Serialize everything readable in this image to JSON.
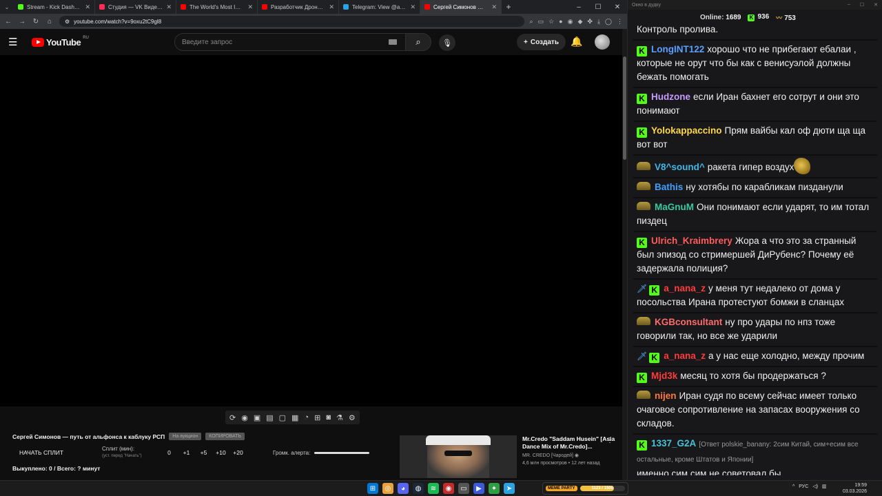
{
  "browser": {
    "tabs": [
      {
        "title": "Stream - Kick Dashboard",
        "color": "#53fc18"
      },
      {
        "title": "Студия — VK Видео Live",
        "color": "#ff2d55"
      },
      {
        "title": "The World's Most Important M",
        "color": "#ff0000"
      },
      {
        "title": "Разработчик Дронов: вся",
        "color": "#ff0000"
      },
      {
        "title": "Telegram: View @asafevitas",
        "color": "#2aa3e0"
      },
      {
        "title": "Сергей Симонов — путь от ал",
        "color": "#ff0000"
      }
    ],
    "url": "youtube.com/watch?v=9oxu2tC9gl8"
  },
  "youtube": {
    "logo_text": "YouTube",
    "region": "RU",
    "search_placeholder": "Введите запрос",
    "create_label": "Создать"
  },
  "info": {
    "video_title": "Сергей Симонов — путь от альфонса к каблуку РСП",
    "pill1": "На аукцион",
    "pill2": "КОПИРОВАТЬ",
    "start_split": "НАЧАТЬ СПЛИТ",
    "split_label": "Сплит (мин):",
    "split_hint": "(уст. перед \"Начать\")",
    "split_values": [
      "0",
      "+1",
      "+5",
      "+10",
      "+20"
    ],
    "alert_label": "Громк. алерта:",
    "alert_volume": 1.0,
    "bought": "Выкуплено: 0 / Всего: ? минут"
  },
  "recommendation": {
    "title": "Mr.Credo \"Saddam Husein\" [Asia Dance Mix of Mr.Credo]...",
    "channel": "MR. CREDO [Чародей]",
    "views": "4,6 млн просмотров • 12 лет назад"
  },
  "chat": {
    "window_title": "Окно в дудку",
    "online_label": "Online:",
    "online_count": "1689",
    "kick_count": "936",
    "yt_count": "753",
    "messages": [
      {
        "badge": "none",
        "user": "",
        "color": "#ffffff",
        "text": "Контроль пролива."
      },
      {
        "badge": "kick",
        "user": "LongINT122",
        "color": "#5aa0ff",
        "text": "хорошо что не прибегают ебалаи , которые не орут что бы как с венисуэлой должны бежать помогать"
      },
      {
        "badge": "kick",
        "user": "Hudzone",
        "color": "#c79bff",
        "text": "если Иран бахнет его сотрут и они это понимают"
      },
      {
        "badge": "kick",
        "user": "Yolokappaccino",
        "color": "#ffd84a",
        "text": "Прям вайбы кал оф дюти ща ща вот вот"
      },
      {
        "badge": "yt",
        "user": "V8^sound^",
        "color": "#3fb8e8",
        "text": "ракета гипер воздух"
      },
      {
        "badge": "yt",
        "user": "Bathis",
        "color": "#3fa0ff",
        "text": "ну хотябы по карабликам пизданули"
      },
      {
        "badge": "yt",
        "user": "MaGnuM",
        "color": "#3cc9a0",
        "text": "Они понимают если ударят, то им тотал пиздец"
      },
      {
        "badge": "kick",
        "user": "Ulrich_Kraimbrery",
        "color": "#ff5c5c",
        "text": "Жора а что это за странный был эпизод со стримершей ДиРубенс? Почему её задержала полиция?"
      },
      {
        "badge": "sword-kick",
        "user": "a_nana_z",
        "color": "#ff3b3b",
        "text": "у меня тут недалеко от дома у посольства Ирана протестуют бомжи в сланцах"
      },
      {
        "badge": "yt",
        "user": "KGBconsultant",
        "color": "#ff6b6b",
        "text": "ну про удары по нпз тоже говорили так, но все же ударили"
      },
      {
        "badge": "sword-kick",
        "user": "a_nana_z",
        "color": "#ff3b3b",
        "text": "а у нас еще холодно, между прочим"
      },
      {
        "badge": "kick",
        "user": "Mjd3k",
        "color": "#ff3b3b",
        "text": "месяц то хотя бы продержаться ?"
      },
      {
        "badge": "yt",
        "user": "nijen",
        "color": "#ff7a3b",
        "text": "Иран судя по всему сейчас имеет только очаговое сопротивление на запасах вооружения со складов."
      },
      {
        "badge": "kick",
        "user": "1337_G2A",
        "color": "#45c3d8",
        "reply": "[Ответ polskie_banany: 2сим Китай, сим+есим все остальные, кроме Штатов и Японии]",
        "text": "именно сим сим не советовал бы"
      }
    ]
  },
  "taskbar": {
    "meme_label": "MEME PARTY",
    "meme_progress": "1123 / 1500",
    "lang": "РУС",
    "time": "19:59",
    "date": "03.03.2026"
  }
}
